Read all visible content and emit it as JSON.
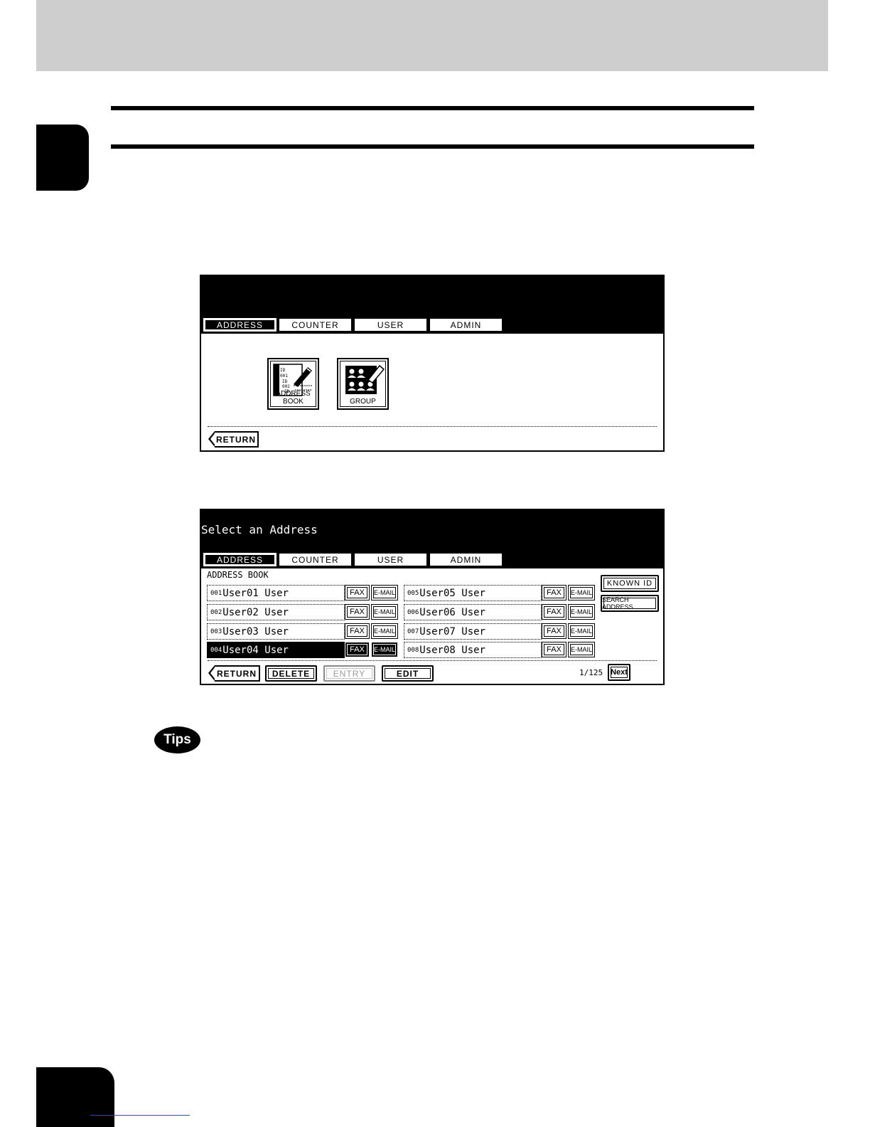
{
  "screen1": {
    "tabs": [
      "ADDRESS",
      "COUNTER",
      "USER",
      "ADMIN"
    ],
    "active_tab": "ADDRESS",
    "icons": [
      {
        "label": "ADDRESS BOOK",
        "icon": "address-book-icon"
      },
      {
        "label": "GROUP",
        "icon": "group-icon"
      }
    ],
    "return_label": "RETURN"
  },
  "screen2": {
    "title": "Select an Address",
    "tabs": [
      "ADDRESS",
      "COUNTER",
      "USER",
      "ADMIN"
    ],
    "active_tab": "ADDRESS",
    "section_label": "ADDRESS BOOK",
    "entries": [
      {
        "num": "001",
        "name": "User01 User",
        "fax": "FAX",
        "email": "E-MAIL",
        "selected": false
      },
      {
        "num": "002",
        "name": "User02 User",
        "fax": "FAX",
        "email": "E-MAIL",
        "selected": false
      },
      {
        "num": "003",
        "name": "User03 User",
        "fax": "FAX",
        "email": "E-MAIL",
        "selected": false
      },
      {
        "num": "004",
        "name": "User04 User",
        "fax": "FAX",
        "email": "E-MAIL",
        "selected": true
      },
      {
        "num": "005",
        "name": "User05 User",
        "fax": "FAX",
        "email": "E-MAIL",
        "selected": false
      },
      {
        "num": "006",
        "name": "User06 User",
        "fax": "FAX",
        "email": "E-MAIL",
        "selected": false
      },
      {
        "num": "007",
        "name": "User07 User",
        "fax": "FAX",
        "email": "E-MAIL",
        "selected": false
      },
      {
        "num": "008",
        "name": "User08 User",
        "fax": "FAX",
        "email": "E-MAIL",
        "selected": false
      }
    ],
    "side_buttons": {
      "known_id": "KNOWN ID",
      "search_address": "SEARCH ADDRESS"
    },
    "bottom_buttons": {
      "return": "RETURN",
      "delete": "DELETE",
      "entry": "ENTRY",
      "edit": "EDIT"
    },
    "page_indicator": "1/125",
    "next_label": "Next"
  },
  "tips": {
    "label": "Tips"
  },
  "colors": {
    "header_band": "#cecece",
    "panel_black": "#000000",
    "link_line": "#2a4bd8",
    "disabled": "#9a9a9a"
  }
}
